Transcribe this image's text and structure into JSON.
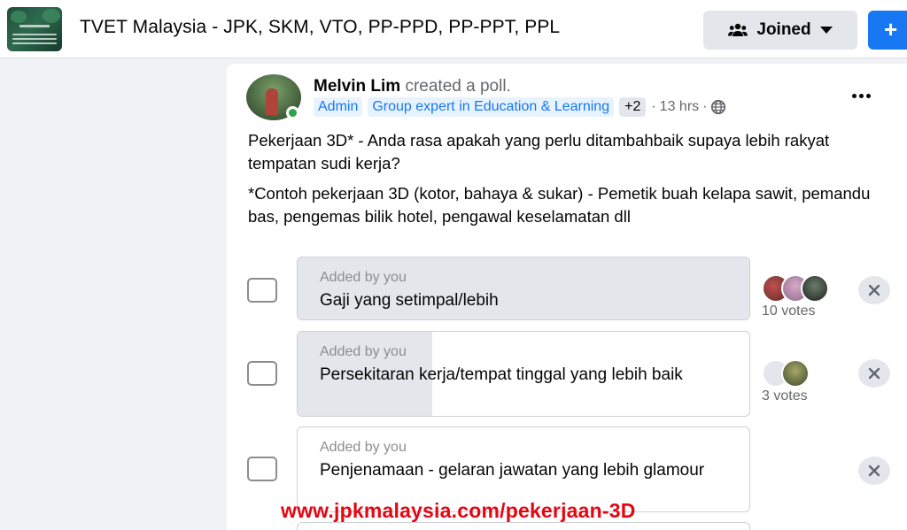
{
  "header": {
    "group_name": "TVET Malaysia - JPK, SKM, VTO, PP-PPD, PP-PPT, PPL",
    "joined_label": "Joined",
    "add_label": "+"
  },
  "post": {
    "author": "Melvin Lim",
    "action": "created a poll.",
    "badges": [
      "Admin",
      "Group expert in Education & Learning"
    ],
    "badges_more": "+2",
    "time": "13 hrs",
    "separator": "·",
    "body_1": "Pekerjaan 3D* - Anda rasa apakah yang perlu ditambahbaik supaya lebih rakyat tempatan sudi kerja?",
    "body_2": "*Contoh pekerjaan 3D (kotor, bahaya & sukar) - Pemetik buah kelapa sawit, pemandu bas, pengemas bilik hotel, pengawal keselamatan dll"
  },
  "poll": {
    "options": [
      {
        "added_by": "Added by you",
        "label": "Gaji yang setimpal/lebih",
        "votes": "10 votes",
        "vote_share": 1.0
      },
      {
        "added_by": "Added by you",
        "label": "Persekitaran kerja/tempat tinggal yang lebih baik",
        "votes": "3 votes",
        "vote_share": 0.3
      },
      {
        "added_by": "Added by you",
        "label": "Penjenamaan - gelaran jawatan yang lebih glamour",
        "votes": "",
        "vote_share": 0
      }
    ]
  },
  "watermark": "www.jpkmalaysia.com/pekerjaan-3D",
  "colors": {
    "accent": "#1877f2",
    "watermark": "#e30613",
    "online": "#31a24c"
  },
  "icons": {
    "joined": "group-people-icon",
    "dropdown": "caret-down-icon",
    "more": "more-horizontal-icon",
    "privacy": "globe-icon",
    "remove": "close-icon"
  }
}
